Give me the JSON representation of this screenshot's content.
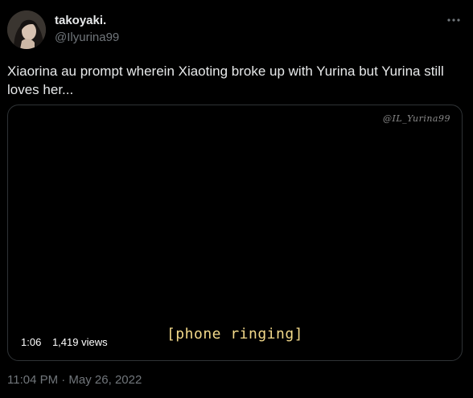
{
  "author": {
    "display_name": "takoyaki.",
    "handle": "@Ilyurina99",
    "avatar": "profile-photo"
  },
  "more_icon": "ellipsis-icon",
  "tweet": {
    "text": "Xiaorina au prompt wherein Xiaoting broke up with Yurina but Yurina still loves her..."
  },
  "video": {
    "watermark": "@IL_Yurina99",
    "subtitle": "[phone ringing]",
    "duration": "1:06",
    "views": "1,419 views"
  },
  "timestamp": "11:04 PM · May 26, 2022",
  "colors": {
    "background": "#000000",
    "primary_text": "#e7e9ea",
    "secondary_text": "#71767b",
    "border": "#2f3336",
    "subtitle": "#f2d98a"
  }
}
